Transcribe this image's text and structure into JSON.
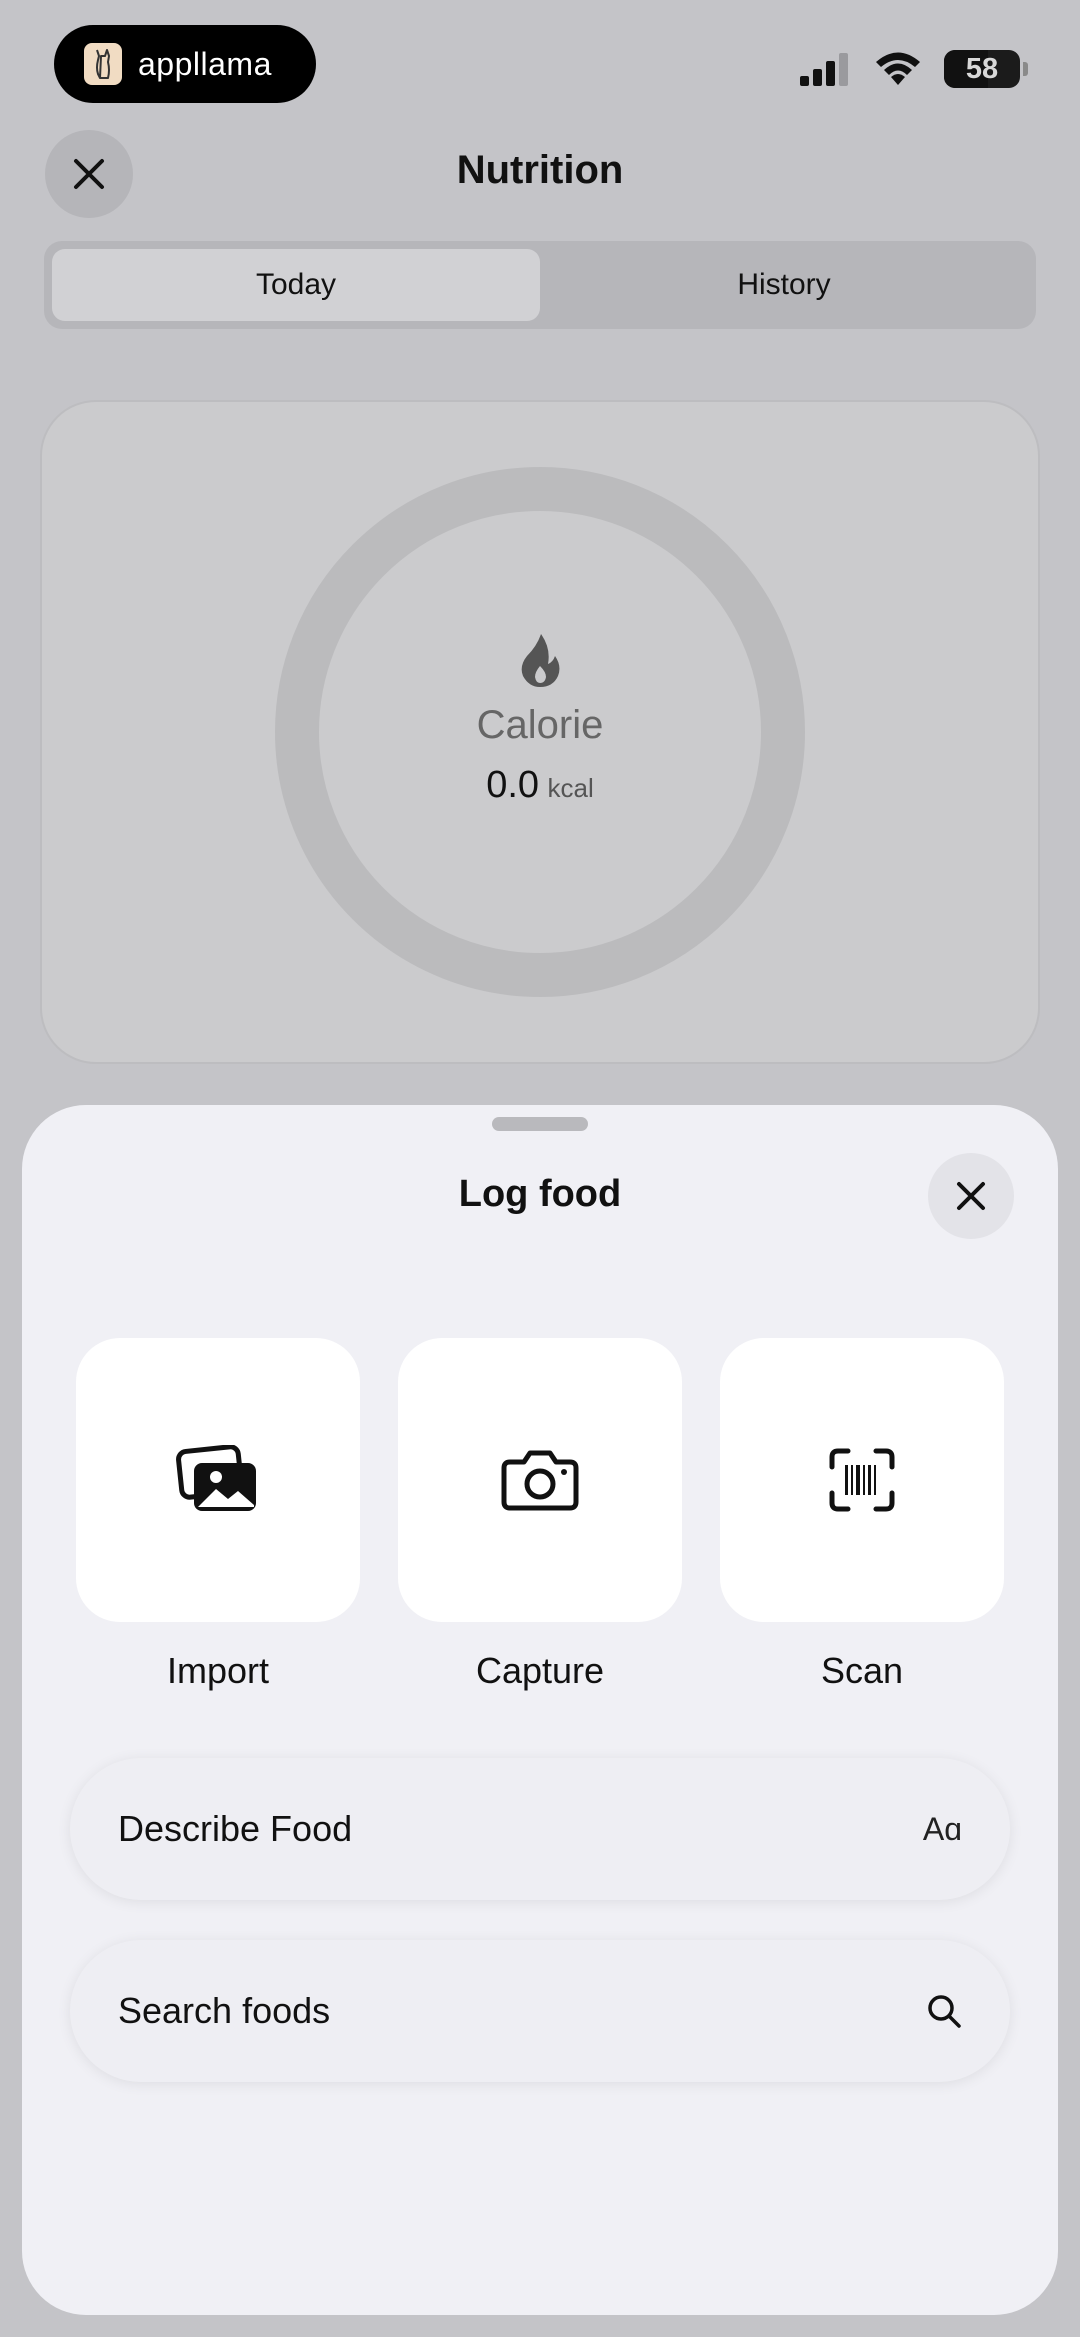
{
  "status_bar": {
    "app_name": "appllama",
    "battery": "58"
  },
  "header": {
    "title": "Nutrition",
    "close_icon": "close-icon"
  },
  "tabs": [
    {
      "label": "Today",
      "active": true
    },
    {
      "label": "History",
      "active": false
    }
  ],
  "calorie": {
    "icon": "flame-icon",
    "label": "Calorie",
    "value": "0.0",
    "unit": "kcal"
  },
  "sheet": {
    "title": "Log food",
    "actions": [
      {
        "label": "Import",
        "icon": "photo-library-icon"
      },
      {
        "label": "Capture",
        "icon": "camera-icon"
      },
      {
        "label": "Scan",
        "icon": "barcode-scan-icon"
      }
    ],
    "describe": {
      "label": "Describe Food",
      "hint": "Aɑ"
    },
    "search": {
      "label": "Search foods",
      "icon": "search-icon"
    }
  },
  "colors": {
    "backdrop": "#c4c4c8",
    "sheet": "#f0f0f5",
    "ring": "#bbbbbd"
  }
}
